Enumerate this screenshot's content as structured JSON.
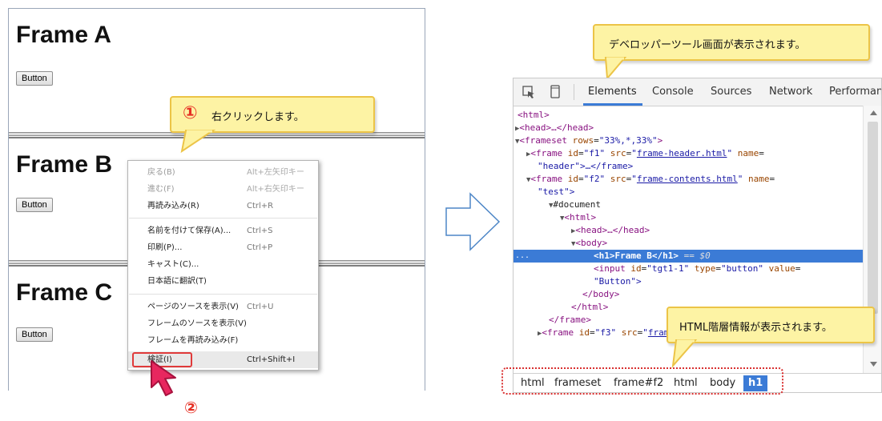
{
  "frames": [
    {
      "title": "Frame A",
      "button": "Button"
    },
    {
      "title": "Frame B",
      "button": "Button"
    },
    {
      "title": "Frame C",
      "button": "Button"
    }
  ],
  "context_menu": {
    "items": [
      {
        "label": "戻る(B)",
        "shortcut": "Alt+左矢印キー",
        "disabled": true
      },
      {
        "label": "進む(F)",
        "shortcut": "Alt+右矢印キー",
        "disabled": true
      },
      {
        "label": "再読み込み(R)",
        "shortcut": "Ctrl+R"
      },
      {
        "label": "名前を付けて保存(A)...",
        "shortcut": "Ctrl+S"
      },
      {
        "label": "印刷(P)...",
        "shortcut": "Ctrl+P"
      },
      {
        "label": "キャスト(C)...",
        "shortcut": ""
      },
      {
        "label": "日本語に翻訳(T)",
        "shortcut": ""
      },
      {
        "label": "ページのソースを表示(V)",
        "shortcut": "Ctrl+U"
      },
      {
        "label": "フレームのソースを表示(V)",
        "shortcut": ""
      },
      {
        "label": "フレームを再読み込み(F)",
        "shortcut": ""
      },
      {
        "label": "検証(I)",
        "shortcut": "Ctrl+Shift+I",
        "highlighted": true
      }
    ]
  },
  "callouts": {
    "step1_number": "①",
    "step1_text": "右クリックします。",
    "step2_number": "②",
    "devtools": "デベロッパーツール画面が表示されます。",
    "html_info": "HTML階層情報が表示されます。"
  },
  "devtools": {
    "tabs": [
      "Elements",
      "Console",
      "Sources",
      "Network",
      "Performan"
    ],
    "active_tab": "Elements",
    "lines": {
      "l1": "<html>",
      "l2_tag": "<head>…</head>",
      "l3_open": "<frameset ",
      "l3_attr": "rows",
      "l3_val": "\"33%,*,33%\"",
      "l3_close": ">",
      "l4_open": "<frame ",
      "l4_id": "id",
      "l4_idv": "\"f1\"",
      "l4_src": "src",
      "l4_srcv": "frame-header.html",
      "l4_name": "name",
      "l5": "\"header\">…</frame>",
      "l6_id": "\"f2\"",
      "l6_srcv": "frame-contents.html",
      "l7": "\"test\">",
      "l8": "#document",
      "l9": "<html>",
      "l10": "<head>…</head>",
      "l11": "<body>",
      "l12_tag_open": "<h1>",
      "l12_text": "Frame B",
      "l12_tag_close": "</h1>",
      "l12_eq": " == $0",
      "l13_open": "<input ",
      "l13_id": "id",
      "l13_idv": "\"tgt1-1\"",
      "l13_type": "type",
      "l13_typev": "\"button\"",
      "l13_value": "value",
      "l14": "\"Button\">",
      "l15": "</body>",
      "l16": "</html>",
      "l17": "</frame>",
      "l18_id": "\"f3\"",
      "l18_srcv": "frame-footer.html",
      "dots": "..."
    },
    "breadcrumb": [
      "html",
      "frameset",
      "frame#f2",
      "html",
      "body",
      "h1"
    ]
  },
  "colors": {
    "highlight": "#3b7bd6",
    "callout_fill": "#fdf3a4",
    "callout_border": "#ecc447",
    "red": "#e03a3a"
  }
}
